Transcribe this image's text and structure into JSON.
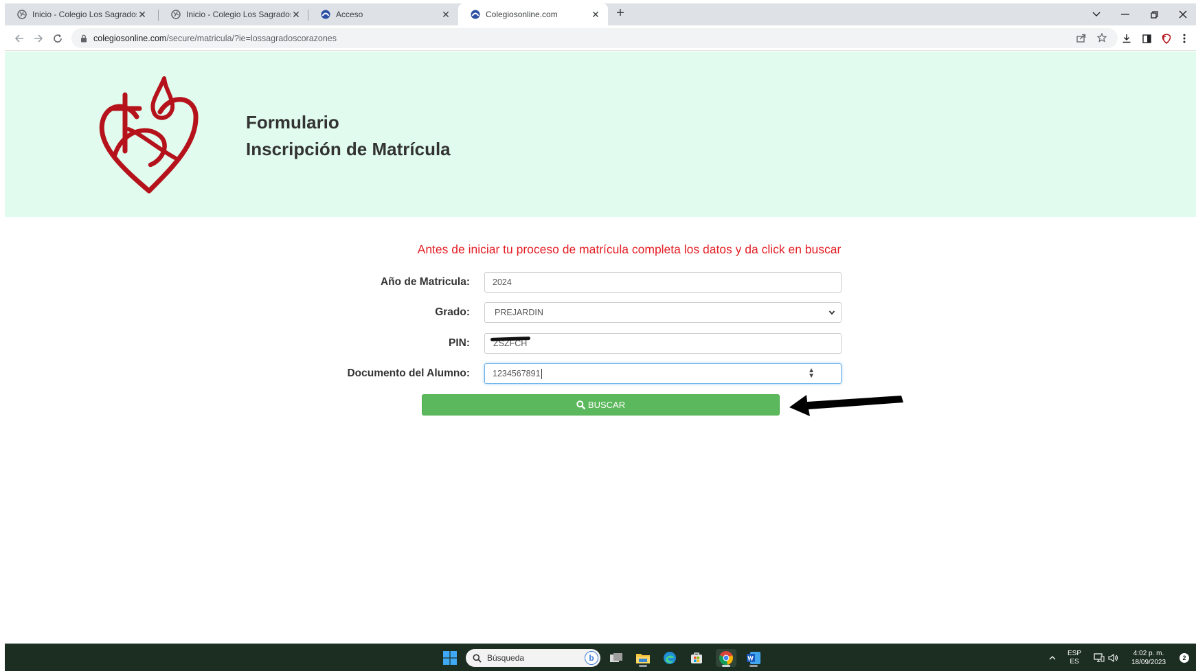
{
  "browser": {
    "tabs": [
      {
        "title": "Inicio - Colegio Los Sagrados Co",
        "active": false
      },
      {
        "title": "Inicio - Colegio Los Sagrados Co",
        "active": false
      },
      {
        "title": "Acceso",
        "active": false
      },
      {
        "title": "Colegiosonline.com",
        "active": true
      }
    ],
    "close_glyph": "✕",
    "new_tab_glyph": "+",
    "url_domain": "colegiosonline.com",
    "url_path": "/secure/matricula/?ie=lossagradoscorazones"
  },
  "header": {
    "title_line1": "Formulario",
    "title_line2": "Inscripción de Matrícula",
    "logo_color": "#b5121b",
    "bg_color": "#e1fcef"
  },
  "form": {
    "intro": "Antes de iniciar tu proceso de matrícula completa los datos y da click en buscar",
    "year_label": "Año de Matricula:",
    "year_value": "2024",
    "grade_label": "Grado:",
    "grade_value": "PREJARDIN",
    "pin_label": "PIN:",
    "pin_value": "ZSZFCH",
    "doc_label": "Documento del Alumno:",
    "doc_value": "1234567891",
    "search_button": "BUSCAR",
    "button_color": "#5cb85c",
    "intro_color": "#e31e24"
  },
  "taskbar": {
    "search_placeholder": "Búsqueda",
    "lang_top": "ESP",
    "lang_bottom": "ES",
    "time": "4:02 p. m.",
    "date": "18/09/2023",
    "notifications": "2"
  }
}
